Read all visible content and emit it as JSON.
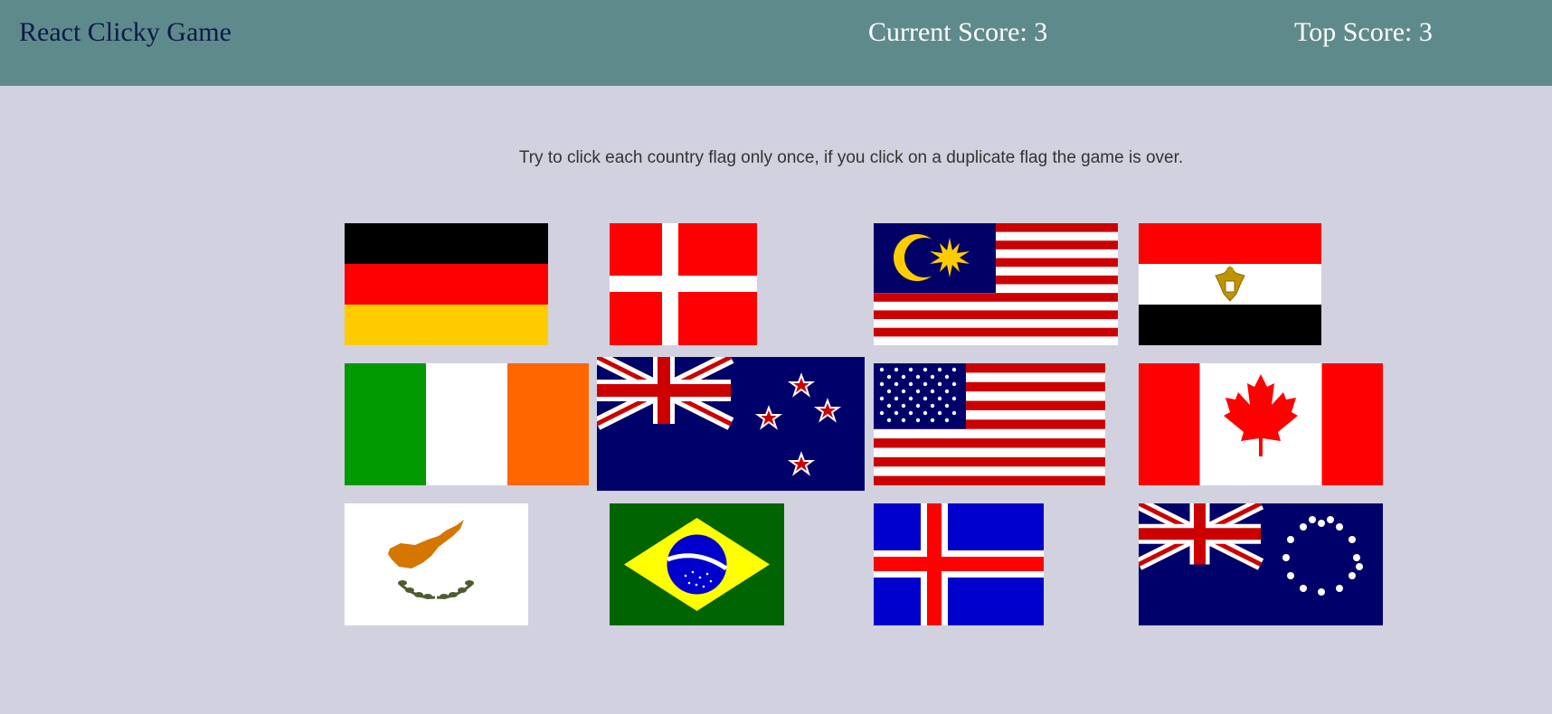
{
  "navbar": {
    "brand": "React Clicky Game",
    "current_score_label": "Current Score: 3",
    "top_score_label": "Top Score: 3"
  },
  "instructions": "Try to click each country flag only once, if you click on a duplicate flag the game is over.",
  "flags": [
    "germany",
    "denmark",
    "malaysia",
    "egypt",
    "ireland",
    "new-zealand",
    "united-states",
    "canada",
    "cyprus",
    "brazil",
    "iceland",
    "cook-islands"
  ],
  "colors": {
    "navbar_bg": "#5f8a8b",
    "page_bg": "#d1d1df",
    "brand_text": "#0b1a4a"
  }
}
